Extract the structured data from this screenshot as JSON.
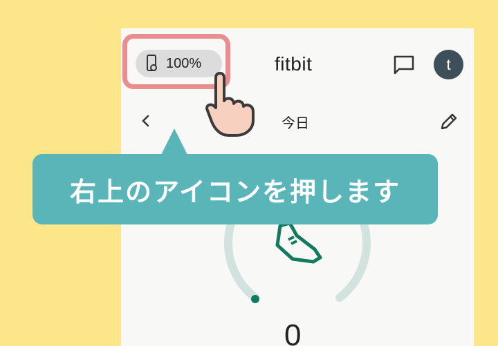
{
  "status": {
    "battery_label": "100%"
  },
  "header": {
    "brand": "fitbit",
    "avatar_initial": "t"
  },
  "nav": {
    "day_label": "今日"
  },
  "callout": {
    "text": "右上のアイコンを押します"
  },
  "dashboard": {
    "steps_value": "0"
  },
  "colors": {
    "background": "#fde68a",
    "highlight": "#e98d8f",
    "callout": "#5ab5b8",
    "accent_green": "#127a5e",
    "ring_track": "#d2e2de"
  },
  "icons": [
    "phone-battery-icon",
    "chat-icon",
    "back-chevron-icon",
    "edit-pencil-icon",
    "shoe-icon",
    "pointer-hand-icon"
  ]
}
